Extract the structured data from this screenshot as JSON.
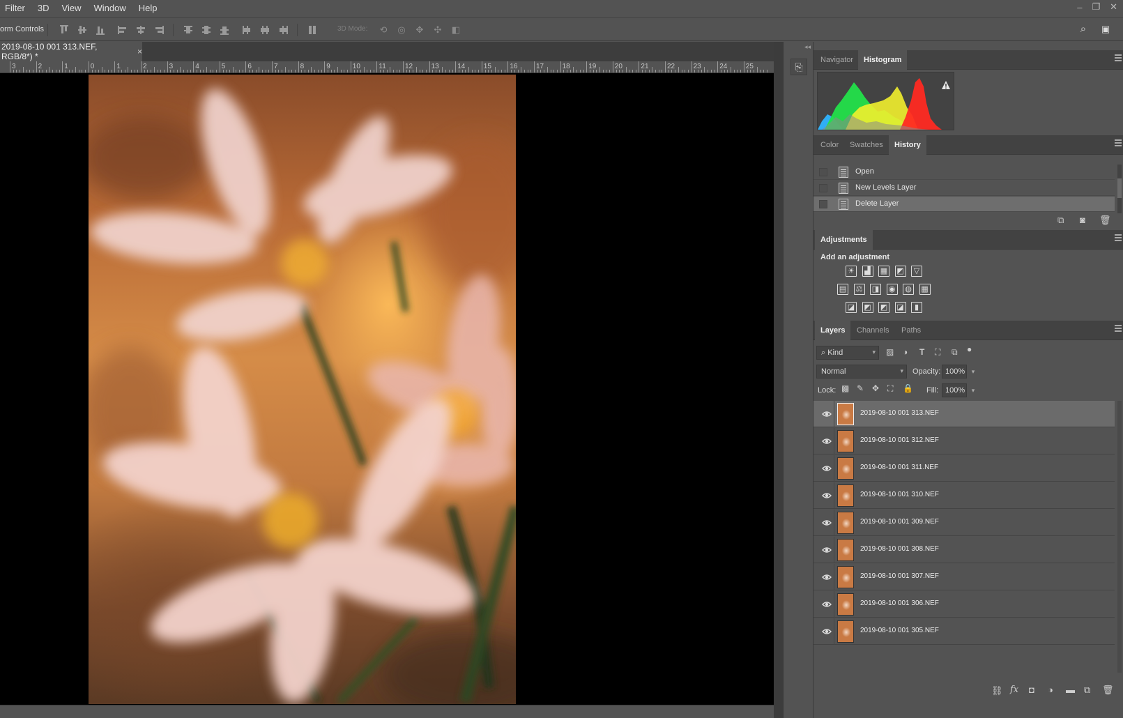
{
  "menu": [
    "Filter",
    "3D",
    "View",
    "Window",
    "Help"
  ],
  "window_controls": [
    "–",
    "❐",
    "✕"
  ],
  "options_bar": {
    "label": "orm Controls",
    "mode3d": "3D Mode:"
  },
  "document": {
    "tab_title": "2019-08-10 001 313.NEF, RGB/8*) *",
    "tab_close": "×"
  },
  "ruler": {
    "labels": [
      "3",
      "2",
      "1",
      "0",
      "1",
      "2",
      "3",
      "4",
      "5",
      "6",
      "7",
      "8",
      "9",
      "10",
      "11",
      "12",
      "13",
      "14",
      "15",
      "16",
      "17",
      "18",
      "19",
      "20",
      "21",
      "22",
      "23",
      "24",
      "25"
    ]
  },
  "panels": {
    "nav_group": {
      "tabs": [
        "Navigator",
        "Histogram"
      ],
      "active": "Histogram"
    },
    "history_group": {
      "tabs": [
        "Color",
        "Swatches",
        "History"
      ],
      "active": "History",
      "items": [
        "Open",
        "New Levels Layer",
        "Delete Layer"
      ],
      "selected": "Delete Layer"
    },
    "adjustments": {
      "tab": "Adjustments",
      "heading": "Add an adjustment",
      "icon_names": [
        [
          "brightness-contrast-icon",
          "levels-icon",
          "curves-icon",
          "exposure-icon",
          "vibrance-icon"
        ],
        [
          "hue-saturation-icon",
          "color-balance-icon",
          "black-white-icon",
          "photo-filter-icon",
          "channel-mixer-icon",
          "color-lookup-icon"
        ],
        [
          "invert-icon",
          "posterize-icon",
          "threshold-icon",
          "selective-color-icon",
          "gradient-map-icon"
        ]
      ]
    },
    "layers": {
      "tabs": [
        "Layers",
        "Channels",
        "Paths"
      ],
      "active": "Layers",
      "filter_kind": "Kind",
      "blend_mode": "Normal",
      "opacity_label": "Opacity:",
      "opacity": "100%",
      "lock_label": "Lock:",
      "fill_label": "Fill:",
      "fill": "100%",
      "items": [
        "2019-08-10 001 313.NEF",
        "2019-08-10 001 312.NEF",
        "2019-08-10 001 311.NEF",
        "2019-08-10 001 310.NEF",
        "2019-08-10 001 309.NEF",
        "2019-08-10 001 308.NEF",
        "2019-08-10 001 307.NEF",
        "2019-08-10 001 306.NEF",
        "2019-08-10 001 305.NEF"
      ],
      "selected_index": 0
    }
  },
  "colors": {
    "ui_bg": "#535353",
    "panel_header": "#424242",
    "selected_row": "#6b6b6b",
    "canvas_bg": "#000000"
  }
}
